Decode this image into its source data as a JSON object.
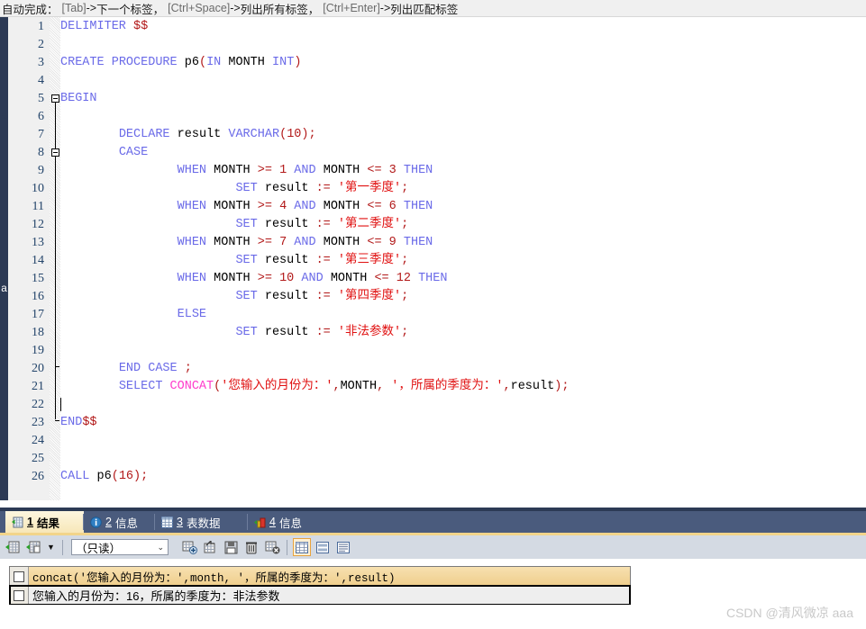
{
  "hint_bar": {
    "label": "自动完成：",
    "items": [
      {
        "key": "[Tab]",
        "arrow": "-> ",
        "text": "下一个标签，"
      },
      {
        "key": "[Ctrl+Space]",
        "arrow": "-> ",
        "text": "列出所有标签，"
      },
      {
        "key": "[Ctrl+Enter]",
        "arrow": "-> ",
        "text": "列出匹配标签"
      }
    ]
  },
  "editor": {
    "line_numbers": [
      "1",
      "2",
      "3",
      "4",
      "5",
      "6",
      "7",
      "8",
      "9",
      "10",
      "11",
      "12",
      "13",
      "14",
      "15",
      "16",
      "17",
      "18",
      "19",
      "20",
      "21",
      "22",
      "23",
      "24",
      "25",
      "26"
    ],
    "ghost_char_left": "a",
    "code_lines": [
      "DELIMITER $$",
      "",
      "CREATE PROCEDURE p6(IN MONTH INT)",
      "",
      "BEGIN",
      "",
      "        DECLARE result VARCHAR(10);",
      "        CASE",
      "                WHEN MONTH >= 1 AND MONTH <= 3 THEN",
      "                        SET result := '第一季度';",
      "                WHEN MONTH >= 4 AND MONTH <= 6 THEN",
      "                        SET result := '第二季度';",
      "                WHEN MONTH >= 7 AND MONTH <= 9 THEN",
      "                        SET result := '第三季度';",
      "                WHEN MONTH >= 10 AND MONTH <= 12 THEN",
      "                        SET result := '第四季度';",
      "                ELSE",
      "                        SET result := '非法参数';",
      "",
      "        END CASE ;",
      "        SELECT CONCAT('您输入的月份为：',MONTH, '，所属的季度为：',result);",
      "",
      "END$$",
      "",
      "",
      "CALL p6(16);"
    ]
  },
  "tabs": [
    {
      "num": "1",
      "label": "结果",
      "icon": "grid-green-icon",
      "active": true
    },
    {
      "num": "2",
      "label": "信息",
      "icon": "info-blue-icon",
      "active": false
    },
    {
      "num": "3",
      "label": "表数据",
      "icon": "table-grid-icon",
      "active": false
    },
    {
      "num": "4",
      "label": "信息",
      "icon": "chart-color-icon",
      "active": false
    }
  ],
  "result_toolbar": {
    "select_value": "（只读）",
    "chevron": "⌄",
    "buttons": [
      {
        "name": "apply-grid-icon",
        "label": ""
      },
      {
        "name": "export-grid-icon",
        "label": ""
      },
      {
        "name": "dropdown-arrow-icon",
        "label": "▼"
      },
      {
        "name": "add-record-icon",
        "label": ""
      },
      {
        "name": "refresh-record-icon",
        "label": ""
      },
      {
        "name": "save-record-icon",
        "label": ""
      },
      {
        "name": "delete-record-icon",
        "label": ""
      },
      {
        "name": "cancel-record-icon",
        "label": ""
      },
      {
        "name": "grid-view-icon",
        "label": ""
      },
      {
        "name": "form-view-icon",
        "label": ""
      },
      {
        "name": "text-view-icon",
        "label": ""
      }
    ]
  },
  "result_grid": {
    "columns": [
      "concat('您输入的月份为：',month, '，所属的季度为：',result)"
    ],
    "rows": [
      [
        "您输入的月份为：16，所属的季度为：非法参数"
      ]
    ]
  },
  "watermark": "CSDN @清风微凉 aaa",
  "colors": {
    "strip": "#2c3a55",
    "tabbar": "#4a5b7d",
    "tab_active": "#f7e7b8",
    "gold_line": "#f2d48a",
    "toolbar": "#d4dae3",
    "keyword": "#6a6ae8",
    "string": "#e01010",
    "number": "#b21818",
    "function": "#ff3ccb",
    "gutter": "#f0f0f0",
    "lineno": "#24456b"
  }
}
